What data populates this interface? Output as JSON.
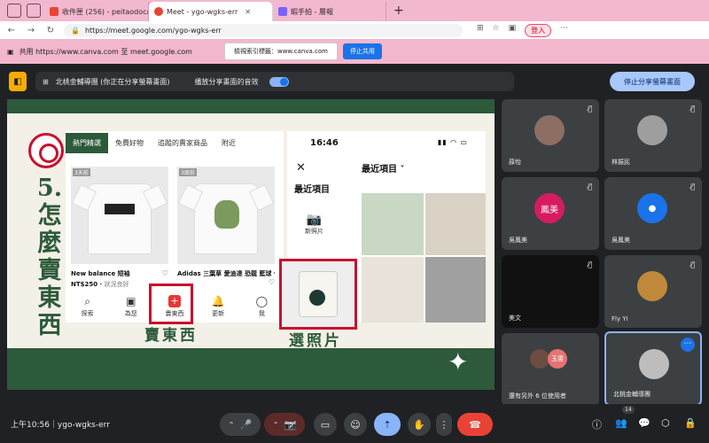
{
  "browser": {
    "tabs": [
      {
        "label": "收件匣 (256) - peitaodoc@gmail...",
        "active": false,
        "favicon_color": "#ea4335"
      },
      {
        "label": "Meet - ygo-wgks-err",
        "active": true,
        "favicon_color": "#ea4335"
      },
      {
        "label": "蝦手拍 - 層報",
        "active": false,
        "favicon_color": "#7b61ff"
      }
    ],
    "url": "https://meet.google.com/ygo-wgks-err",
    "login_label": "登入"
  },
  "share_bar": {
    "text": "共用 https://www.canva.com 至 meet.google.com",
    "tab_button": "檢視索引標籤：www.canva.com",
    "stop_button": "停止共用"
  },
  "meet_bar": {
    "presenting_text": "北桃金輔導團 (你正在分享螢幕畫面)",
    "audio_text": "播放分享畫面的音效",
    "stop_presenting_button": "停止分享螢幕畫面"
  },
  "slide": {
    "vertical_title": "5. 怎麼賣東西",
    "phone1": {
      "tabs": [
        "熱門精選",
        "免費好物",
        "追蹤的賣家商品",
        "附近"
      ],
      "cards": [
        {
          "tag": "3天前",
          "title": "New balance 短袖",
          "price": "NT$250",
          "condition": "狀況良好"
        },
        {
          "tag": "3周前",
          "title": "Adidas 三葉草 愛迪達 恐龍 藍球 化石 極新 L",
          "price": "",
          "condition": ""
        }
      ],
      "nav": [
        "探索",
        "為您",
        "賣東西",
        "更新",
        "我"
      ]
    },
    "phone2": {
      "time": "16:46",
      "recent_menu": "最近項目",
      "section_label": "最近項目",
      "camera_label": "新照片"
    },
    "caption_sell": "賣東西",
    "caption_photo": "選照片"
  },
  "participants": [
    {
      "name": "薛怡",
      "avatar_color": "#8d6e63",
      "initials": ""
    },
    {
      "name": "林振民",
      "avatar_color": "#9e9e9e",
      "initials": ""
    },
    {
      "name": "吳鳳美",
      "avatar_color": "#d81b60",
      "initials": "鳳美"
    },
    {
      "name": "吳鳳美",
      "avatar_color": "#1a73e8",
      "initials": ""
    },
    {
      "name": "美文",
      "avatar_color": "",
      "initials": ""
    },
    {
      "name": "Fly Yi",
      "avatar_color": "#c0883a",
      "initials": ""
    },
    {
      "name": "還有另外 6 位使用者",
      "avatar_color": "#6d4c41",
      "initials": "玉雯"
    },
    {
      "name": "北桃金輔導團",
      "avatar_color": "#bdbdbd",
      "initials": ""
    }
  ],
  "bottom": {
    "time_code": "上午10:56｜ygo-wgks-err",
    "people_count": "14"
  },
  "colors": {
    "accent_blue": "#8ab4f8",
    "end_call_red": "#ea4335",
    "slide_green": "#2d5a3a",
    "highlight_red": "#c8102e"
  }
}
